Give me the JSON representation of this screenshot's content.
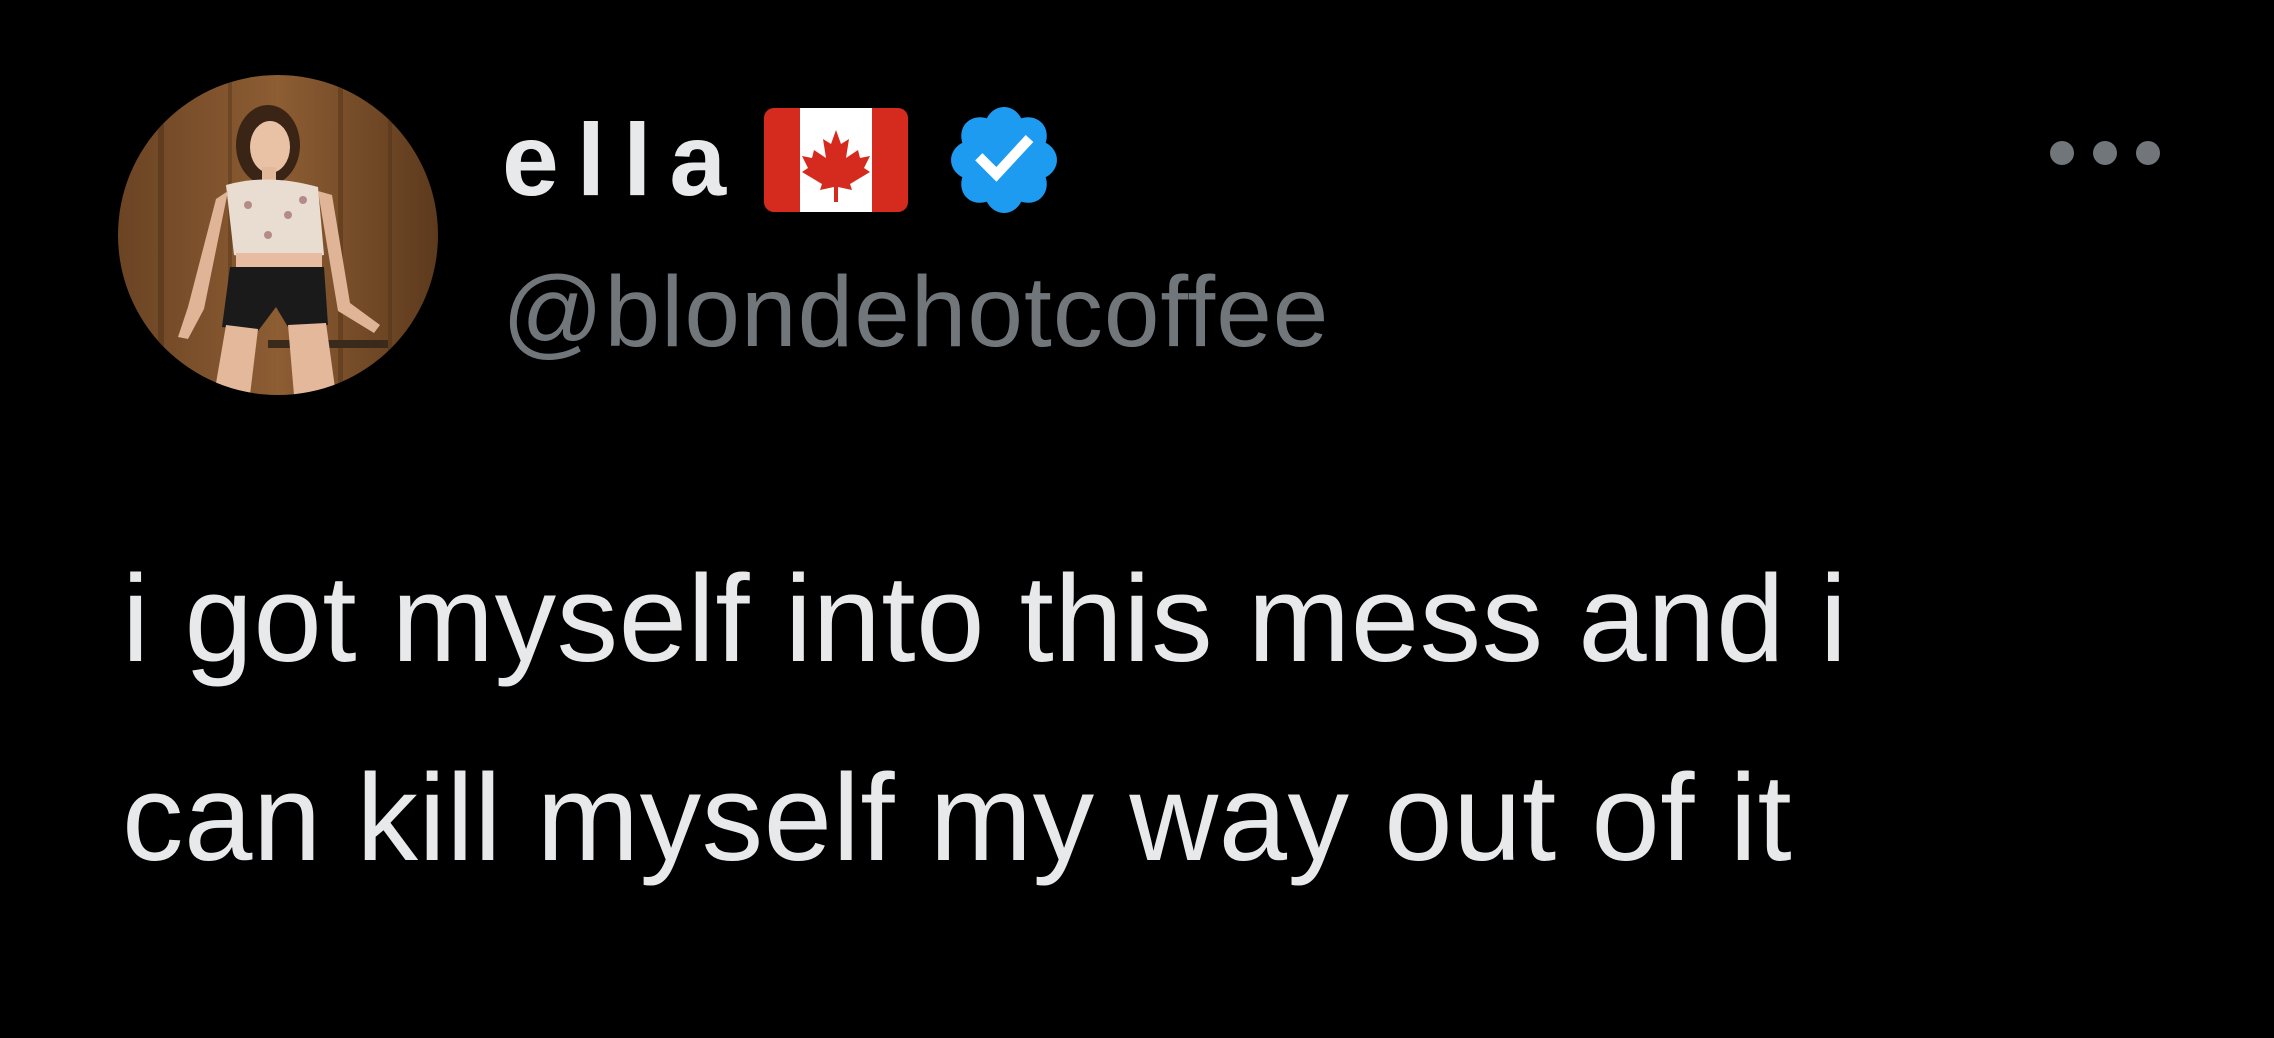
{
  "tweet": {
    "author": {
      "display_name": "ella",
      "handle": "@blondehotcoffee",
      "avatar_icon": "profile-photo",
      "flag_icon": "canada-flag-emoji",
      "verified_icon": "verified-badge-icon"
    },
    "more_icon": "more-options-icon",
    "text_lines": [
      "i got myself into this mess and i",
      "can kill myself my way out of it"
    ]
  },
  "colors": {
    "background": "#000000",
    "primary_text": "#e7e9ea",
    "secondary_text": "#71767b",
    "verified_blue": "#1d9bf0",
    "flag_red": "#d52b1e"
  }
}
